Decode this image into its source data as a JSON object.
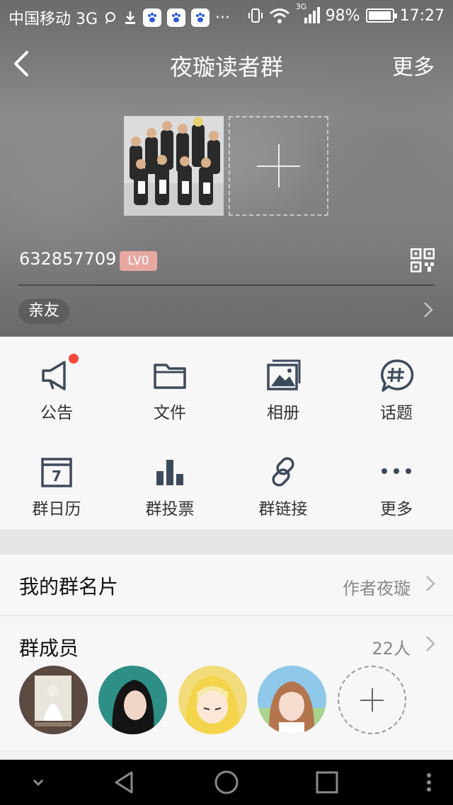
{
  "status_bar": {
    "carrier": "中国移动 3G",
    "signal_type": "3G",
    "battery": "98%",
    "time": "17:27",
    "more_dots": "···"
  },
  "nav": {
    "title": "夜璇读者群",
    "more": "更多"
  },
  "group": {
    "id": "632857709",
    "level": "LV0",
    "tag": "亲友"
  },
  "features": [
    {
      "label": "公告",
      "icon": "megaphone-icon"
    },
    {
      "label": "文件",
      "icon": "folder-icon"
    },
    {
      "label": "相册",
      "icon": "album-icon"
    },
    {
      "label": "话题",
      "icon": "topic-hashtag-icon"
    },
    {
      "label": "群日历",
      "icon": "calendar-icon"
    },
    {
      "label": "群投票",
      "icon": "vote-bar-icon"
    },
    {
      "label": "群链接",
      "icon": "link-icon"
    },
    {
      "label": "更多",
      "icon": "more-dots-icon"
    }
  ],
  "calendar_day": "7",
  "my_card": {
    "title": "我的群名片",
    "value": "作者夜璇"
  },
  "members": {
    "title": "群成员",
    "count": "22人"
  },
  "colors": {
    "accent_red": "#f4493a",
    "badge": "#e8a8a2"
  }
}
